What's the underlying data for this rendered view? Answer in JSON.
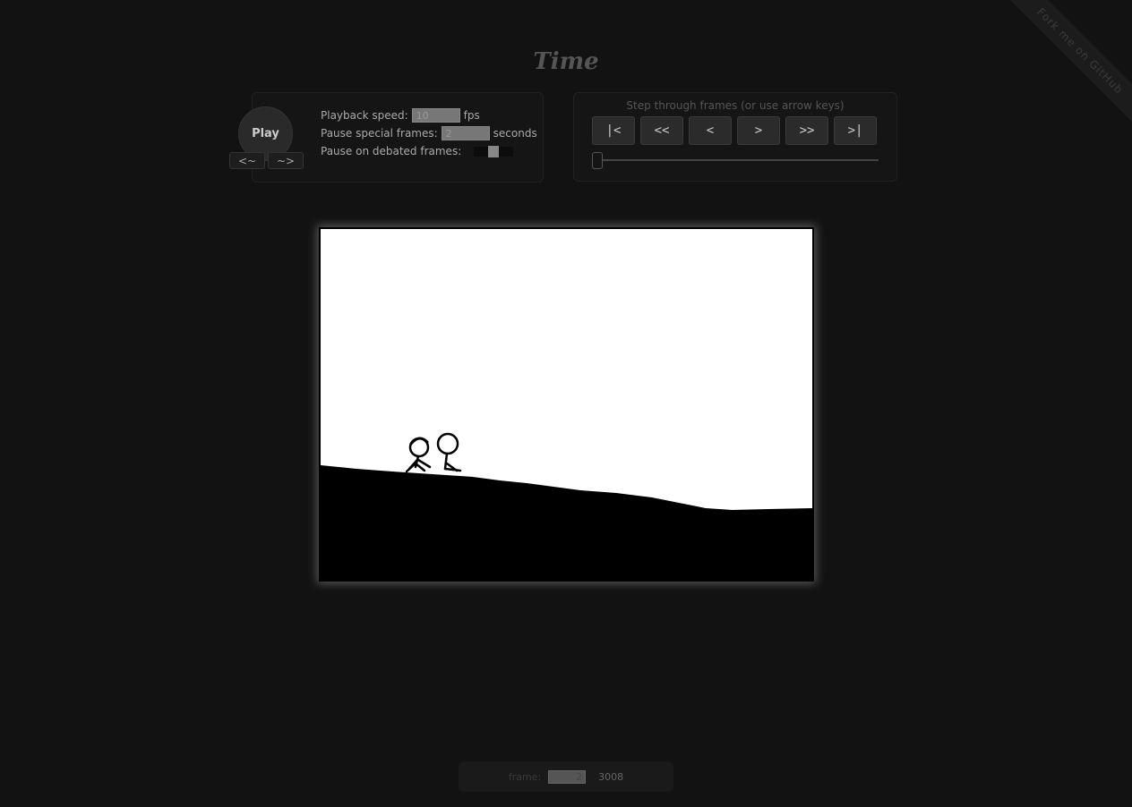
{
  "ribbon": {
    "text": "Fork me on GitHub"
  },
  "page": {
    "title": "Time"
  },
  "playback": {
    "play_label": "Play",
    "back_label": "<~",
    "forward_label": "~>",
    "speed_label": "Playback speed:",
    "speed_value": "10",
    "speed_unit": "fps",
    "pause_special_label": "Pause special frames:",
    "pause_special_value": "2",
    "pause_special_unit": "seconds",
    "debated_label": "Pause on debated frames:"
  },
  "stepper": {
    "label": "Step through frames (or use arrow keys)",
    "first": "|<",
    "back_many": "<<",
    "back_one": "<",
    "forward_one": ">",
    "forward_many": ">>",
    "last": ">|",
    "position_fraction": 0.0
  },
  "footer": {
    "frame_label": "frame:",
    "frame_value": "2",
    "frame_total": "3008"
  }
}
